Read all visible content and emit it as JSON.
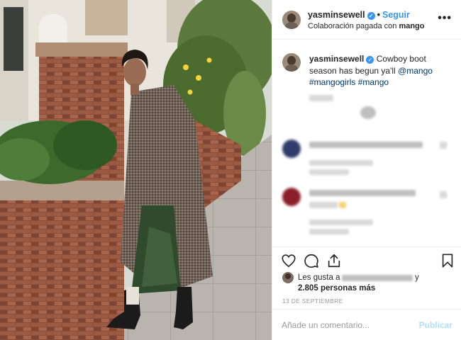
{
  "post": {
    "username": "yasminsewell",
    "follow_label": "Seguir",
    "subtitle_prefix": "Colaboración pagada con",
    "subtitle_brand": "mango",
    "caption_text": "Cowboy boot season has begun ya'll",
    "caption_mention": "@mango",
    "caption_tags": "#mangogirls #mango",
    "likes_prefix": "Les gusta a",
    "likes_suffix": "y",
    "likes_count": "2.805 personas más",
    "date": "13 DE SEPTIEMBRE",
    "comment_placeholder": "Añade un comentario...",
    "publish_label": "Publicar"
  },
  "icons": {
    "verified": "verified-badge-icon",
    "more": "more-options-icon",
    "like": "heart-icon",
    "comment": "comment-icon",
    "share": "share-icon",
    "save": "bookmark-icon"
  },
  "colors": {
    "accent": "#3897f0",
    "hashtag": "#003569",
    "muted": "#999999",
    "publish_disabled": "#b2dffc"
  }
}
